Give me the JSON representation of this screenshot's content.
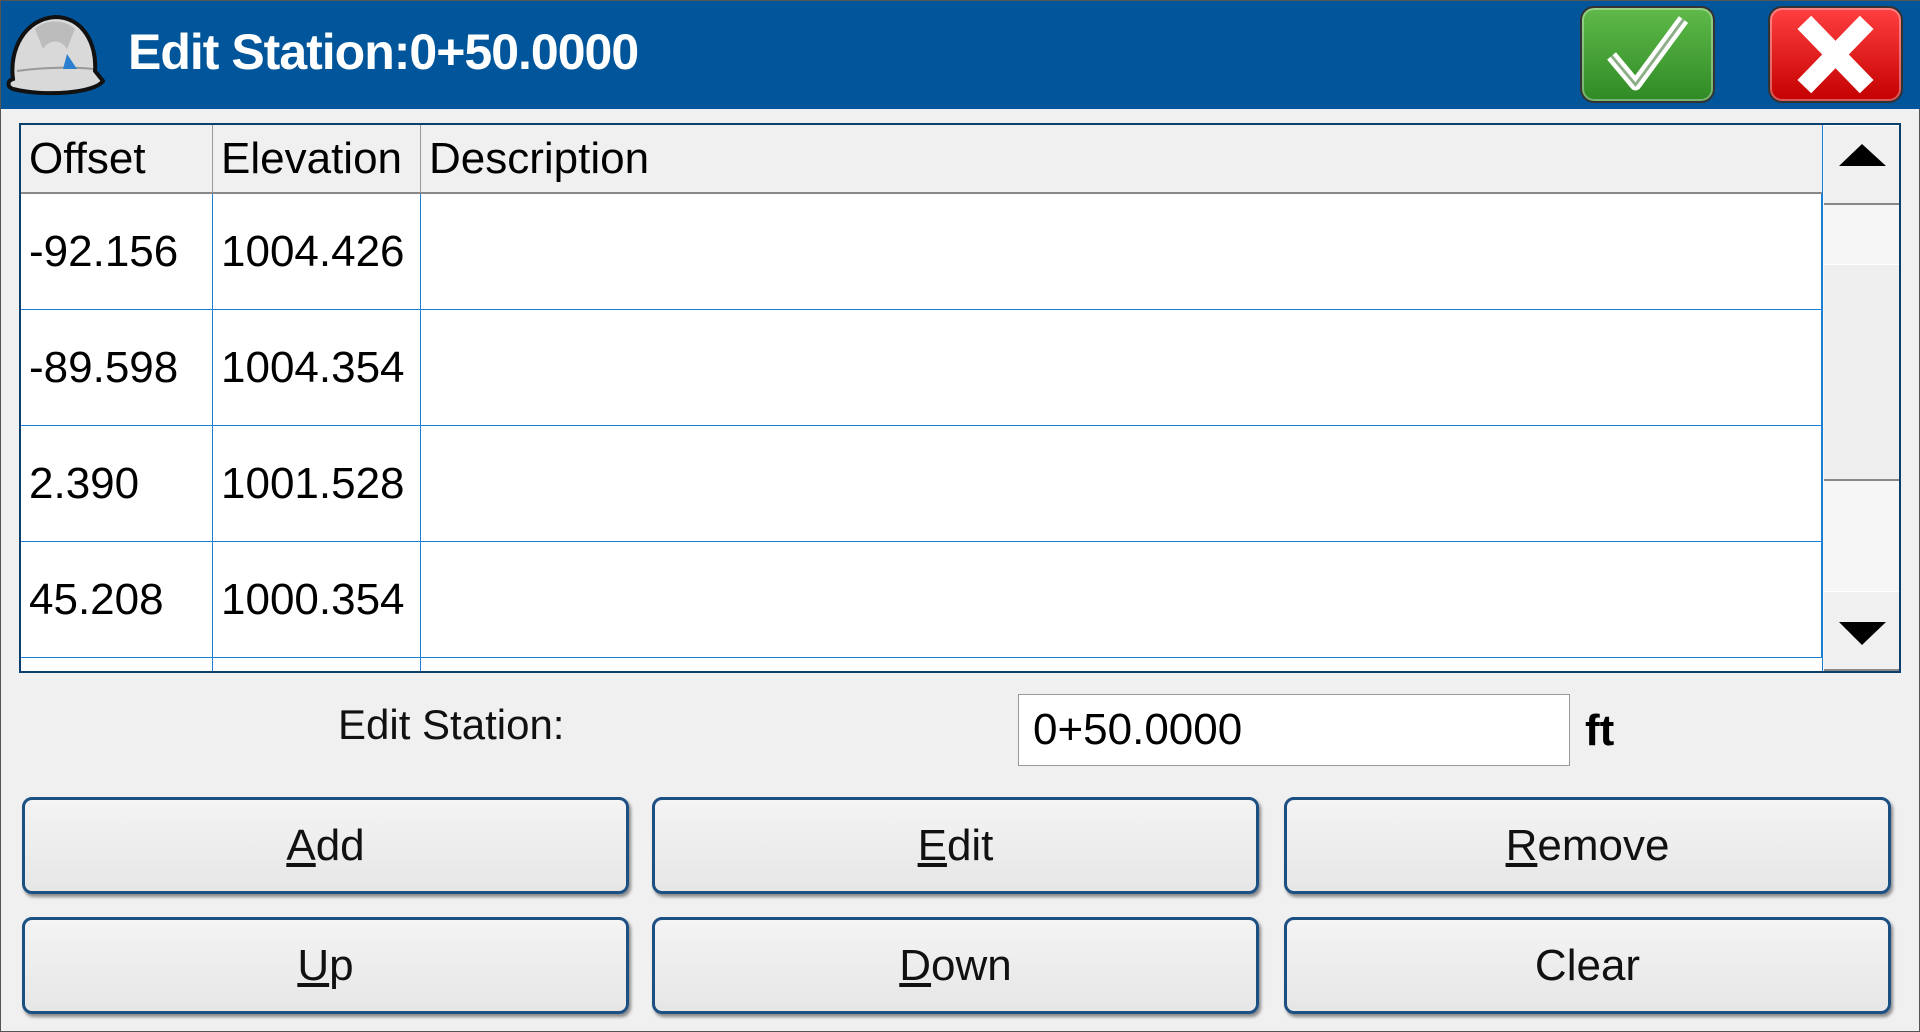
{
  "window": {
    "title": "Edit Station:0+50.0000",
    "ok_icon": "checkmark-icon",
    "cancel_icon": "close-x-icon",
    "brand_color": "#01559a"
  },
  "table": {
    "columns": [
      "Offset",
      "Elevation",
      "Description"
    ],
    "rows": [
      {
        "offset": "-92.156",
        "elevation": "1004.426",
        "description": ""
      },
      {
        "offset": "-89.598",
        "elevation": "1004.354",
        "description": ""
      },
      {
        "offset": "2.390",
        "elevation": "1001.528",
        "description": ""
      },
      {
        "offset": "45.208",
        "elevation": "1000.354",
        "description": ""
      }
    ]
  },
  "station": {
    "label": "Edit Station:",
    "value": "0+50.0000",
    "unit": "ft"
  },
  "buttons": [
    {
      "mn": "A",
      "rest": "dd"
    },
    {
      "mn": "E",
      "rest": "dit"
    },
    {
      "mn": "R",
      "rest": "emove"
    },
    {
      "mn": "U",
      "rest": "p"
    },
    {
      "mn": "D",
      "rest": "own"
    },
    {
      "mn": "",
      "rest": "Clear"
    }
  ]
}
